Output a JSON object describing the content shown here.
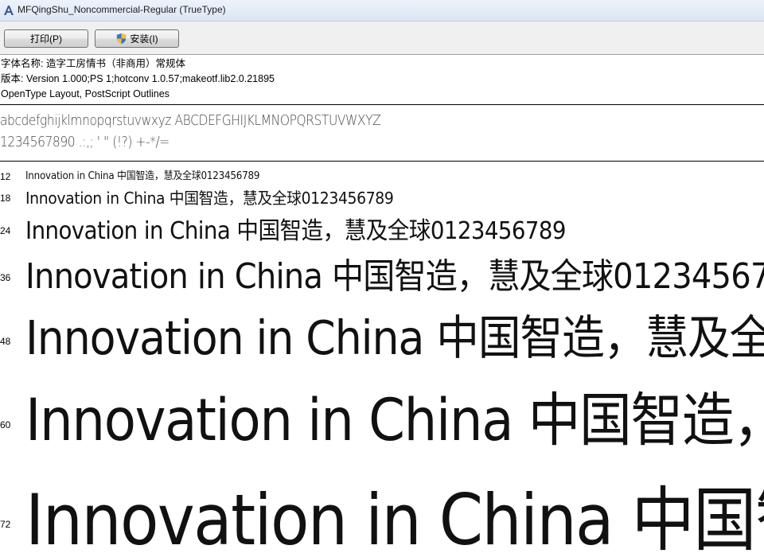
{
  "window": {
    "title": "MFQingShu_Noncommercial-Regular (TrueType)"
  },
  "toolbar": {
    "print_label": "打印(P)",
    "install_label": "安装(I)"
  },
  "font_info": {
    "name_line": "字体名称: 造字工房情书（非商用）常规体",
    "version_line": "版本: Version 1.000;PS 1;hotconv 1.0.57;makeotf.lib2.0.21895",
    "type_line": "OpenType Layout, PostScript Outlines"
  },
  "charset": {
    "letters": "abcdefghijklmnopqrstuvwxyz ABCDEFGHIJKLMNOPQRSTUVWXYZ",
    "digits": "1234567890 .:,; ' \" (!?) +-*/="
  },
  "specimen": {
    "sample_text": "Innovation in China 中国智造，慧及全球0123456789",
    "sizes": [
      "12",
      "18",
      "24",
      "36",
      "48",
      "60",
      "72"
    ]
  }
}
